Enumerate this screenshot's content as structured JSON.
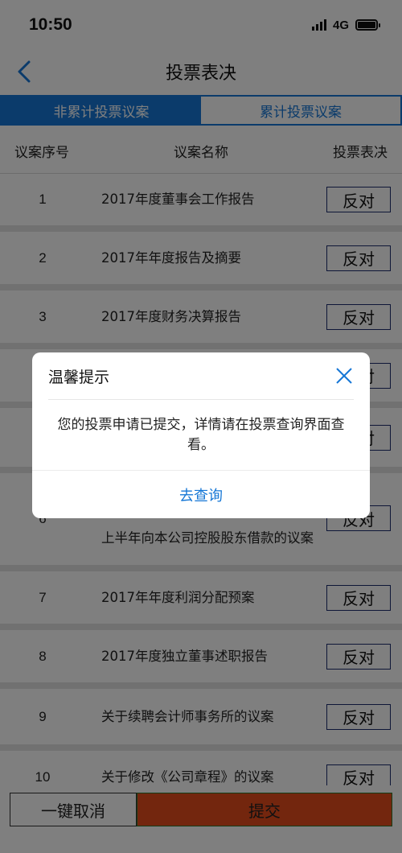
{
  "status": {
    "time": "10:50",
    "network": "4G"
  },
  "nav": {
    "title": "投票表决",
    "back_icon": "chevron-left-icon"
  },
  "tabs": [
    {
      "label": "非累计投票议案",
      "active": true
    },
    {
      "label": "累计投票议案",
      "active": false
    }
  ],
  "table": {
    "headers": {
      "no": "议案序号",
      "name": "议案名称",
      "vote": "投票表决"
    },
    "rows": [
      {
        "no": "1",
        "name": "2017年度董事会工作报告",
        "vote": "反对"
      },
      {
        "no": "2",
        "name": "2017年年度报告及摘要",
        "vote": "反对"
      },
      {
        "no": "3",
        "name": "2017年度财务决算报告",
        "vote": "反对"
      },
      {
        "no": "",
        "name": "",
        "vote": "反对"
      },
      {
        "no": "",
        "name": "",
        "vote": "反对"
      },
      {
        "no": "6",
        "name": "上半年向本公司控股股东借款的议案",
        "vote": "反对"
      },
      {
        "no": "7",
        "name": "2017年年度利润分配预案",
        "vote": "反对"
      },
      {
        "no": "8",
        "name": "2017年度独立董事述职报告",
        "vote": "反对"
      },
      {
        "no": "9",
        "name": "关于续聘会计师事务所的议案",
        "vote": "反对"
      },
      {
        "no": "10",
        "name": "关于修改《公司章程》的议案",
        "vote": "反对"
      }
    ]
  },
  "bottom": {
    "cancel_label": "一键取消",
    "submit_label": "提交"
  },
  "dialog": {
    "title": "温馨提示",
    "message": "您的投票申请已提交，详情请在投票查询界面查看。",
    "action_label": "去查询"
  },
  "colors": {
    "accent": "#1677d6",
    "submit": "#e74c1c",
    "overlay": "rgba(0,0,0,0.5)"
  }
}
